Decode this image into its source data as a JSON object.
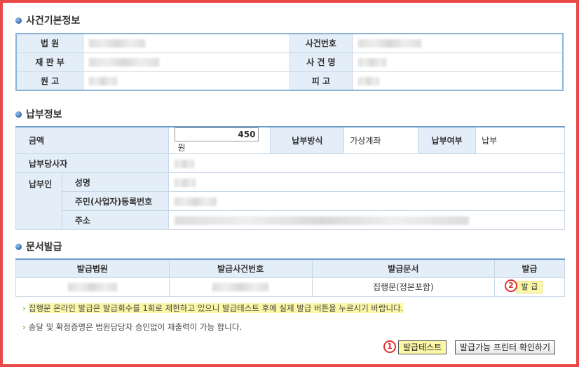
{
  "section1": {
    "title": "사건기본정보",
    "labels": [
      "법 원",
      "사건번호",
      "재 판 부",
      "사 건 명",
      "원 고",
      "피 고"
    ]
  },
  "section2": {
    "title": "납부정보",
    "amount_label": "금액",
    "amount_value": "450",
    "amount_unit": "원",
    "method_label": "납부방식",
    "method_value": "가상계좌",
    "paid_label": "납부여부",
    "paid_value": "납부",
    "payer_person_label": "납부당사자",
    "payer_label": "납부인",
    "name_label": "성명",
    "reg_label": "주민(사업자)등록번호",
    "addr_label": "주소"
  },
  "section3": {
    "title": "문서발급",
    "headers": [
      "발급법원",
      "발급사건번호",
      "발급문서",
      "발급"
    ],
    "row": {
      "doc": "집행문(정본포함)",
      "issue_button": "발 급"
    }
  },
  "notes": [
    "집행문 온라인 발급은 발급회수를 1회로 제한하고 있으니 발급테스트 후에 실제 발급 버튼을 누르시기 바랍니다.",
    "송달 및 확정증명은 법원담당자 승인없이 재출력이 가능 합니다."
  ],
  "buttons": {
    "test": "발급테스트",
    "printer_check": "발급가능 프린터 확인하기"
  },
  "markers": {
    "one": "1",
    "two": "2"
  },
  "colors": {
    "frame": "#e84848",
    "label_bg": "#e4eef8",
    "highlight": "#fbf7a6",
    "marker": "#e03030"
  }
}
